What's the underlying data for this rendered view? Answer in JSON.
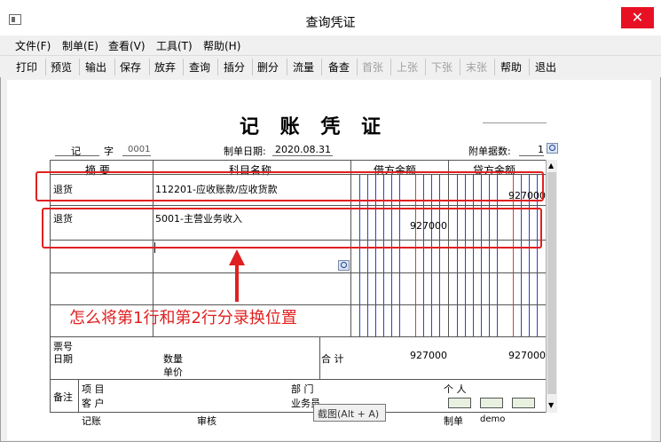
{
  "window": {
    "title": "查询凭证",
    "close_glyph": "✕"
  },
  "menu": [
    "文件(F)",
    "制单(E)",
    "查看(V)",
    "工具(T)",
    "帮助(H)"
  ],
  "toolbar": {
    "print": "打印",
    "preview": "预览",
    "export": "输出",
    "save": "保存",
    "discard": "放弃",
    "query": "查询",
    "insert_entry": "插分",
    "delete_entry": "删分",
    "flow": "流量",
    "reference": "备查",
    "first": "首张",
    "prev": "上张",
    "next": "下张",
    "last": "末张",
    "help": "帮助",
    "exit": "退出"
  },
  "voucher": {
    "title": "记 账 凭 证",
    "type_label": "记",
    "char_label": "字",
    "number": "0001",
    "date_label": "制单日期:",
    "date": "2020.08.31",
    "attachments_label": "附单据数:",
    "attachments": "1"
  },
  "columns": {
    "summary": "摘 要",
    "account": "科目名称",
    "debit": "借方金额",
    "credit": "贷方金额"
  },
  "rows": [
    {
      "summary": "退货",
      "account": "112201-应收账款/应收货款",
      "debit": "",
      "credit": "927000"
    },
    {
      "summary": "退货",
      "account": "5001-主营业务收入",
      "debit": "927000",
      "credit": ""
    }
  ],
  "footer": {
    "ticket_no": "票号",
    "date": "日期",
    "quantity": "数量",
    "unit_price": "单价",
    "total_label": "合 计",
    "total_debit": "927000",
    "total_credit": "927000",
    "remarks": "备注",
    "project": "项 目",
    "customer": "客 户",
    "department": "部 门",
    "salesperson": "业务员",
    "individual": "个 人"
  },
  "signatures": {
    "bookkeeper": "记账",
    "reviewer": "审核",
    "preparer": "制单",
    "preparer_name": "demo"
  },
  "annotation": {
    "question": "怎么将第1行和第2行分录换位置"
  },
  "tooltip": "截图(Alt + A)",
  "colors": {
    "annotation": "#e02020",
    "close": "#e81123",
    "money_line": "#3040c8"
  }
}
